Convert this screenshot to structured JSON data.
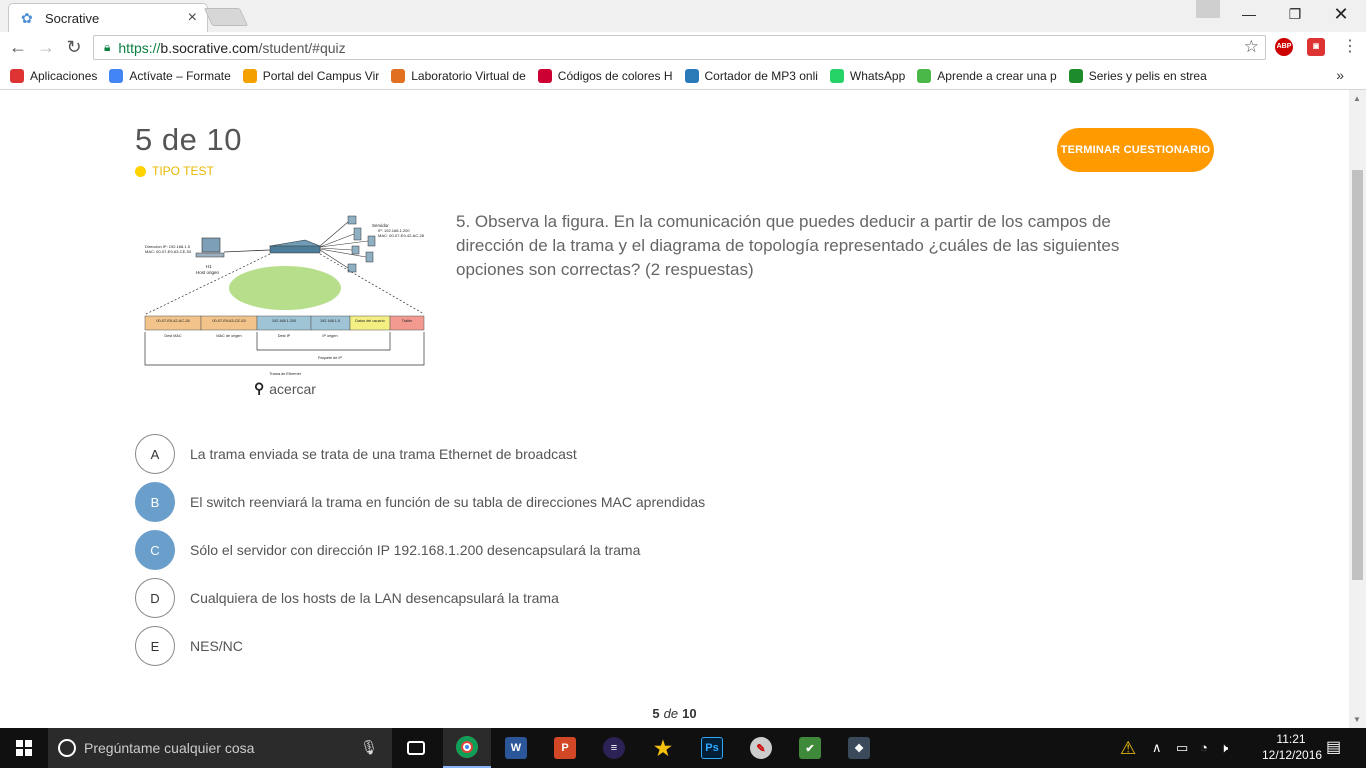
{
  "browser": {
    "tab_title": "Socrative",
    "tab_close": "×",
    "url_secure": "https://",
    "url_host": "b.socrative.com",
    "url_path": "/student/#quiz",
    "bookmarks": [
      {
        "label": "Aplicaciones",
        "icon": "apps-grid-icon",
        "color": "#d33"
      },
      {
        "label": "Actívate – Formate",
        "icon": "google-icon",
        "color": "#4285f4"
      },
      {
        "label": "Portal del Campus Vir",
        "icon": "campus-icon",
        "color": "#f4a000"
      },
      {
        "label": "Laboratorio Virtual de",
        "icon": "lab-icon",
        "color": "#e07020"
      },
      {
        "label": "Códigos de colores H",
        "icon": "color-wheel-icon",
        "color": "#c03"
      },
      {
        "label": "Cortador de MP3 onli",
        "icon": "scissors-icon",
        "color": "#2a7ab8"
      },
      {
        "label": "WhatsApp",
        "icon": "whatsapp-icon",
        "color": "#25d366"
      },
      {
        "label": "Aprende a crear una p",
        "icon": "udemy-icon",
        "color": "#4ab848"
      },
      {
        "label": "Series y pelis en strea",
        "icon": "series-icon",
        "color": "#1d8a2c"
      }
    ],
    "more_bookmarks": "»"
  },
  "quiz": {
    "counter": "5 de 10",
    "question_type": "TIPO TEST",
    "finish_button": "TERMINAR CUESTIONARIO",
    "question": "5. Observa la figura. En la comunicación que puedes deducir a partir de los campos de dirección de la trama y el diagrama de topología representado ¿cuáles de las siguientes opciones son correctas? (2 respuestas)",
    "zoom_label": "acercar",
    "answers": [
      {
        "letter": "A",
        "text": "La trama enviada se trata de una trama Ethernet de broadcast",
        "selected": false
      },
      {
        "letter": "B",
        "text": "El switch reenviará la trama en función de su tabla de direcciones MAC aprendidas",
        "selected": true
      },
      {
        "letter": "C",
        "text": "Sólo el servidor con dirección IP 192.168.1.200 desencapsulará la trama",
        "selected": true
      },
      {
        "letter": "D",
        "text": "Cualquiera de los hosts de la LAN desencapsulará la trama",
        "selected": false
      },
      {
        "letter": "E",
        "text": "NES/NC",
        "selected": false
      }
    ],
    "pager": {
      "current": "5",
      "of": "de",
      "total": "10"
    },
    "accent_color": "#ff9b00",
    "selected_color": "#6a9fcc",
    "type_color": "#ffd200"
  },
  "figure": {
    "host_label_1": "Dirección IP: 192.168.1.5",
    "host_label_2": "MAC: 00-07-E9-63-CE-53",
    "host_name": "H1",
    "host_role": "Host origen",
    "server_title": "Servidor",
    "server_ip": "IP: 192.168.1.200",
    "server_mac": "MAC: 00-07-E9-42-AC-28",
    "fields": [
      "00-07-E9-42-AC-28",
      "00-07-E9-63-CE-53",
      "192.168.1.200",
      "192.168.1.5",
      "Datos del usuario",
      "Tráiler"
    ],
    "field_labels": [
      "Dest MAC",
      "MAC de origen",
      "Dest IP",
      "IP origen"
    ],
    "packet_label": "Paquete de IP",
    "frame_label": "Trama de Ethernet"
  },
  "taskbar": {
    "search_placeholder": "Pregúntame cualquier cosa",
    "time": "11:21",
    "date": "12/12/2016"
  }
}
